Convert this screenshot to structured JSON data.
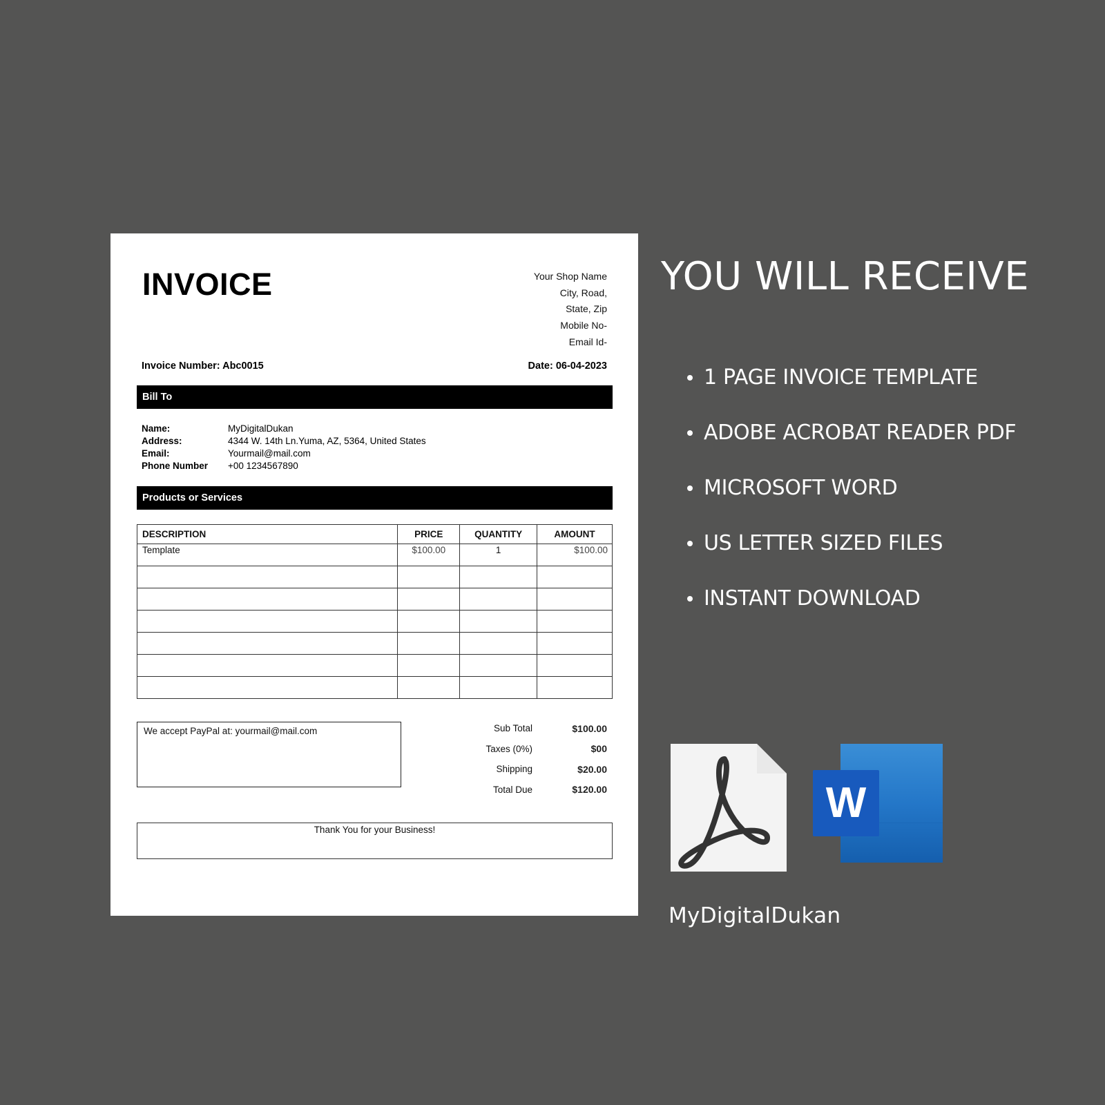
{
  "invoice": {
    "title": "INVOICE",
    "shop": [
      "Your Shop Name",
      "City, Road,",
      "State, Zip",
      "Mobile No-",
      "Email Id-"
    ],
    "invoice_number": "Invoice Number: Abc0015",
    "date": "Date: 06-04-2023",
    "bill_to_header": "Bill To",
    "bill_to": [
      {
        "label": "Name:",
        "value": "MyDigitalDukan"
      },
      {
        "label": "Address:",
        "value": "4344 W. 14th Ln.Yuma, AZ, 5364, United States"
      },
      {
        "label": "Email:",
        "value": "Yourmail@mail.com"
      },
      {
        "label": "Phone Number",
        "value": "+00 1234567890"
      }
    ],
    "products_header": "Products or Services",
    "columns": [
      "DESCRIPTION",
      "PRICE",
      "QUANTITY",
      "AMOUNT"
    ],
    "rows": [
      [
        "Template",
        "$100.00",
        "1",
        "$100.00"
      ],
      [
        "",
        "",
        "",
        ""
      ],
      [
        "",
        "",
        "",
        ""
      ],
      [
        "",
        "",
        "",
        ""
      ],
      [
        "",
        "",
        "",
        ""
      ],
      [
        "",
        "",
        "",
        ""
      ],
      [
        "",
        "",
        "",
        ""
      ]
    ],
    "paypal_note": "We accept PayPal at: yourmail@mail.com",
    "totals": [
      {
        "label": "Sub Total",
        "value": "$100.00"
      },
      {
        "label": "Taxes (0%)",
        "value": "$00"
      },
      {
        "label": "Shipping",
        "value": "$20.00"
      },
      {
        "label": "Total Due",
        "value": "$120.00"
      }
    ],
    "thanks": "Thank You for your Business!"
  },
  "promo": {
    "headline": "YOU WILL RECEIVE",
    "bullets": [
      "1 PAGE INVOICE TEMPLATE",
      "ADOBE ACROBAT READER PDF",
      "MICROSOFT WORD",
      "US LETTER SIZED FILES",
      "INSTANT DOWNLOAD"
    ],
    "icons": [
      "adobe-acrobat-pdf-icon",
      "microsoft-word-icon"
    ],
    "word_letter": "W",
    "brand": "MyDigitalDukan"
  },
  "colors": {
    "background": "#545453",
    "word_blue": "#185abd",
    "word_light": "#2b7cd3"
  }
}
